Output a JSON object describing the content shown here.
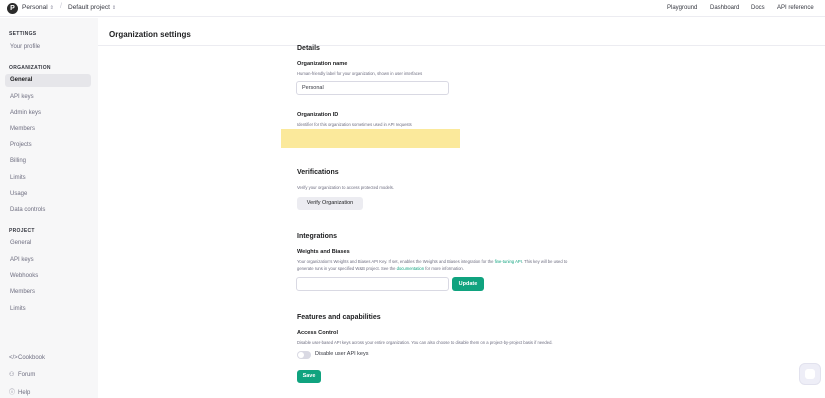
{
  "header": {
    "logo_letter": "P",
    "org_name": "Personal",
    "project_name": "Default project",
    "links": [
      "Playground",
      "Dashboard",
      "Docs",
      "API reference"
    ]
  },
  "sidebar": {
    "settings_head": "SETTINGS",
    "your_profile": "Your profile",
    "organization_head": "ORGANIZATION",
    "org_items": [
      "General",
      "API keys",
      "Admin keys",
      "Members",
      "Projects",
      "Billing",
      "Limits",
      "Usage",
      "Data controls"
    ],
    "project_head": "PROJECT",
    "project_items": [
      "General",
      "API keys",
      "Webhooks",
      "Members",
      "Limits"
    ],
    "footer": [
      "Cookbook",
      "Forum",
      "Help"
    ]
  },
  "page": {
    "title": "Organization settings"
  },
  "details": {
    "heading": "Details",
    "org_name_label": "Organization name",
    "org_name_desc": "Human-friendly label for your organization, shown in user interfaces",
    "org_name_value": "Personal",
    "org_id_label": "Organization ID",
    "org_id_desc": "Identifier for this organization sometimes used in API requests"
  },
  "verifications": {
    "heading": "Verifications",
    "desc": "Verify your organization to access protected models.",
    "button": "Verify Organization"
  },
  "integrations": {
    "heading": "Integrations",
    "wandb_label": "Weights and Biases",
    "wandb_desc_1a": "Your organization's Weights and Biases API Key. If set, enables the Weights and Biases integration for the ",
    "wandb_desc_1_link": "fine-tuning API",
    "wandb_desc_1b": ". This key will be used to",
    "wandb_desc_2a": "generate runs in your specified W&B project. See the ",
    "wandb_desc_2_link": "documentation",
    "wandb_desc_2b": " for more information.",
    "update_button": "Update"
  },
  "features": {
    "heading": "Features and capabilities",
    "access_label": "Access Control",
    "access_desc": "Disable user-based API keys across your entire organization. You can also choose to disable them on a project-by-project basis if needed.",
    "toggle_label": "Disable user API keys",
    "toggle_on": false,
    "save_button": "Save"
  },
  "colors": {
    "accent": "#10a37f",
    "highlight": "#fbe99b"
  }
}
